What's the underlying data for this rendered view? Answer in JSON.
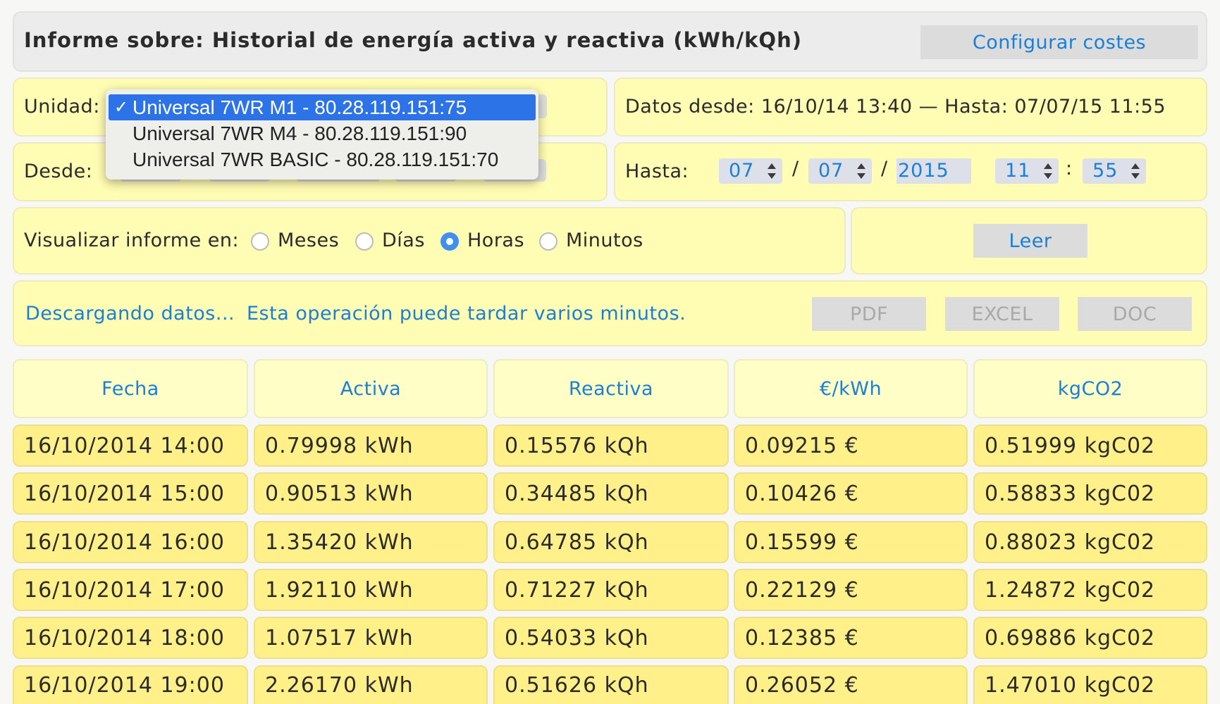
{
  "header": {
    "title": "Informe sobre: Historial de energía activa y reactiva (kWh/kQh)",
    "config_button": "Configurar costes"
  },
  "unit": {
    "label": "Unidad:",
    "options": [
      "Universal 7WR M1 - 80.28.119.151:75",
      "Universal 7WR M4 - 80.28.119.151:90",
      "Universal 7WR BASIC - 80.28.119.151:70"
    ],
    "selected_check": "✓"
  },
  "data_range": "Datos desde: 16/10/14 13:40 — Hasta: 07/07/15 11:55",
  "from": {
    "label": "Desde:"
  },
  "to": {
    "label": "Hasta:",
    "day": "07",
    "month": "07",
    "year": "2015",
    "hour": "11",
    "minute": "55",
    "sep_date": "/",
    "sep_time": ":"
  },
  "view": {
    "label": "Visualizar informe en:",
    "options": [
      "Meses",
      "Días",
      "Horas",
      "Minutos"
    ],
    "selected": "Horas"
  },
  "read_button": "Leer",
  "status": {
    "loading": "Descargando datos...",
    "note": "Esta operación puede tardar varios minutos."
  },
  "export": {
    "pdf": "PDF",
    "excel": "EXCEL",
    "doc": "DOC"
  },
  "table": {
    "headers": [
      "Fecha",
      "Activa",
      "Reactiva",
      "€/kWh",
      "kgCO2"
    ],
    "rows": [
      [
        "16/10/2014 14:00",
        "0.79998 kWh",
        "0.15576 kQh",
        "0.09215 €",
        "0.51999 kgC02"
      ],
      [
        "16/10/2014 15:00",
        "0.90513 kWh",
        "0.34485 kQh",
        "0.10426 €",
        "0.58833 kgC02"
      ],
      [
        "16/10/2014 16:00",
        "1.35420 kWh",
        "0.64785 kQh",
        "0.15599 €",
        "0.88023 kgC02"
      ],
      [
        "16/10/2014 17:00",
        "1.92110 kWh",
        "0.71227 kQh",
        "0.22129 €",
        "1.24872 kgC02"
      ],
      [
        "16/10/2014 18:00",
        "1.07517 kWh",
        "0.54033 kQh",
        "0.12385 €",
        "0.69886 kgC02"
      ],
      [
        "16/10/2014 19:00",
        "2.26170 kWh",
        "0.51626 kQh",
        "0.26052 €",
        "1.47010 kgC02"
      ]
    ]
  },
  "colors": {
    "accent": "#1a7fd6",
    "panel_yellow": "#fffcb3",
    "row_yellow": "#fff089",
    "selected_blue": "#2b73e6"
  }
}
